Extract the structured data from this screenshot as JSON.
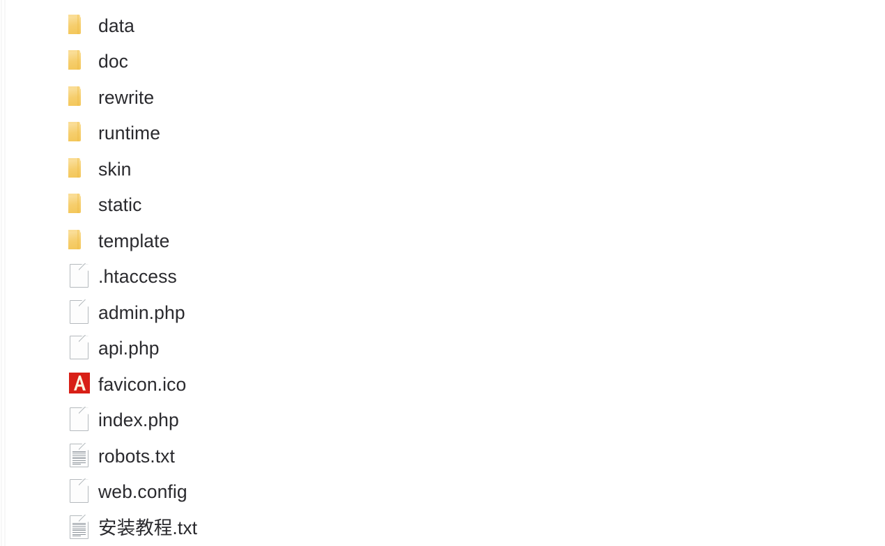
{
  "view": {
    "background_color": "#ffffff",
    "text_color": "#2a2a2e",
    "folder_icon_color": "#f6ce6d",
    "favicon_color": "#d81f16",
    "page_icon_border_color": "#b4b9bd"
  },
  "files": [
    {
      "name": "data",
      "icon": "folder-icon",
      "type": "folder"
    },
    {
      "name": "doc",
      "icon": "folder-icon",
      "type": "folder"
    },
    {
      "name": "rewrite",
      "icon": "folder-icon",
      "type": "folder"
    },
    {
      "name": "runtime",
      "icon": "folder-icon",
      "type": "folder"
    },
    {
      "name": "skin",
      "icon": "folder-icon",
      "type": "folder"
    },
    {
      "name": "static",
      "icon": "folder-icon",
      "type": "folder"
    },
    {
      "name": "template",
      "icon": "folder-icon",
      "type": "folder"
    },
    {
      "name": ".htaccess",
      "icon": "blank-page-icon",
      "type": "file"
    },
    {
      "name": "admin.php",
      "icon": "blank-page-icon",
      "type": "file"
    },
    {
      "name": "api.php",
      "icon": "blank-page-icon",
      "type": "file"
    },
    {
      "name": "favicon.ico",
      "icon": "favicon-a-icon",
      "type": "file"
    },
    {
      "name": "index.php",
      "icon": "blank-page-icon",
      "type": "file"
    },
    {
      "name": "robots.txt",
      "icon": "text-page-icon",
      "type": "file"
    },
    {
      "name": "web.config",
      "icon": "blank-page-icon",
      "type": "file"
    },
    {
      "name": "安装教程.txt",
      "icon": "text-page-icon",
      "type": "file"
    }
  ]
}
